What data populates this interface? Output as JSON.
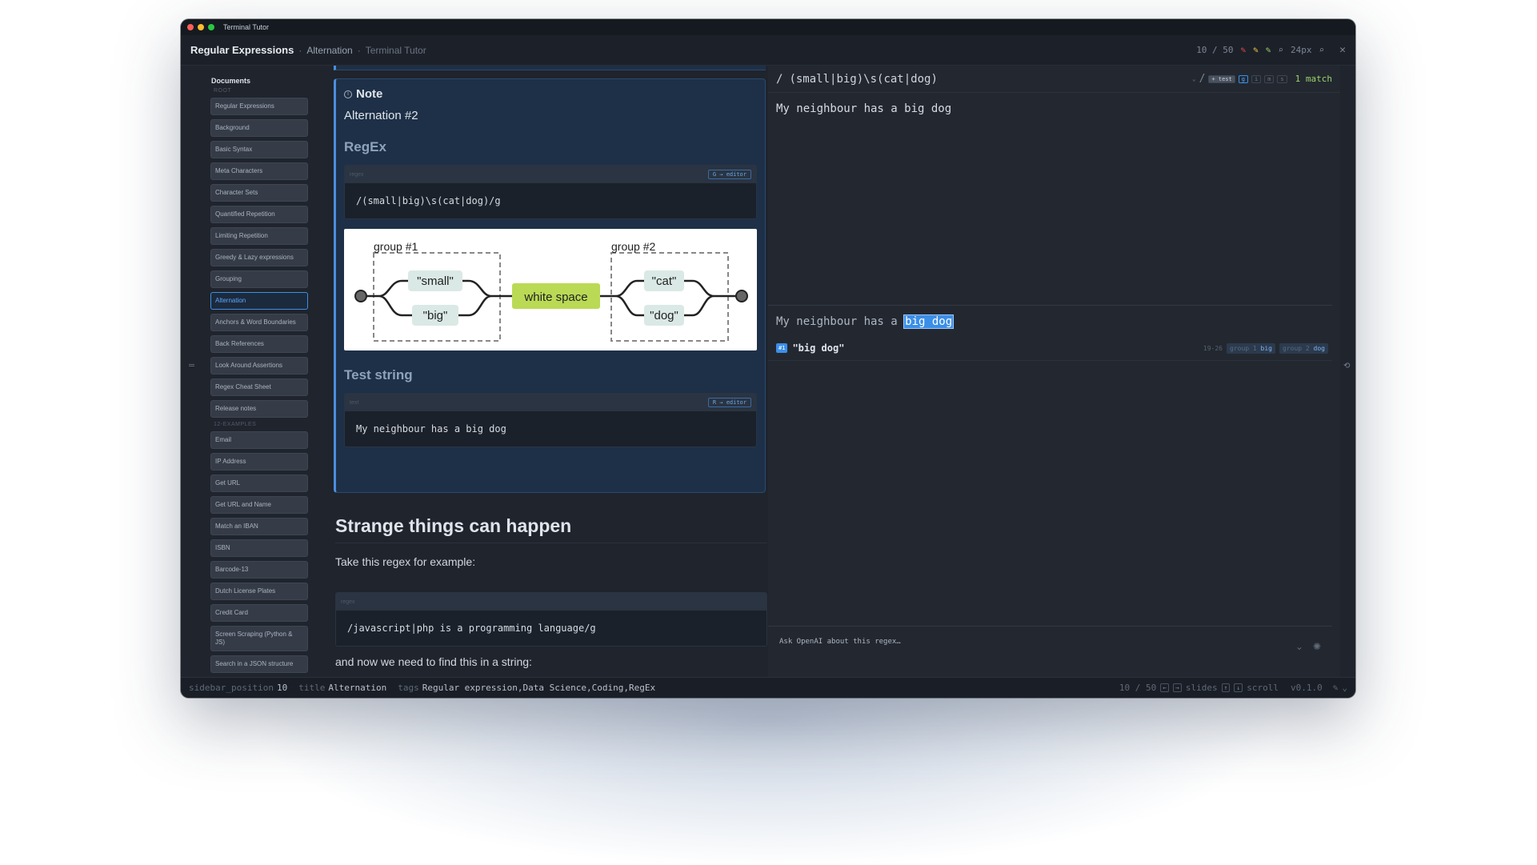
{
  "window": {
    "title": "Terminal Tutor"
  },
  "header": {
    "breadcrumb_main": "Regular Expressions",
    "breadcrumb_page": "Alternation",
    "breadcrumb_app": "Terminal Tutor",
    "page_counter": "10 / 50",
    "zoom": "24px"
  },
  "sidebar": {
    "heading": "Documents",
    "root_label": "ROOT",
    "items": [
      "Regular Expressions",
      "Background",
      "Basic Syntax",
      "Meta Characters",
      "Character Sets",
      "Quantified Repetition",
      "Limiting Repetition",
      "Greedy & Lazy expressions",
      "Grouping",
      "Alternation",
      "Anchors & Word Boundaries",
      "Back References",
      "Look Around Assertions",
      "Regex Cheat Sheet",
      "Release notes"
    ],
    "examples_label": "12-EXAMPLES",
    "examples": [
      "Email",
      "IP Address",
      "Get URL",
      "Get URL and Name",
      "Match an IBAN",
      "ISBN",
      "Barcode-13",
      "Dutch License Plates",
      "Credit Card",
      "Screen Scraping (Python & JS)",
      "Search in a JSON structure"
    ]
  },
  "document": {
    "note_title": "Note",
    "note_subtitle": "Alternation #2",
    "regex_heading": "RegEx",
    "regex_lang": "regex",
    "regex_edit": "G → editor",
    "regex_code": "/(small|big)\\s(cat|dog)/g",
    "diagram": {
      "group1": "group #1",
      "group2": "group #2",
      "small": "\"small\"",
      "big": "\"big\"",
      "space": "white space",
      "cat": "\"cat\"",
      "dog": "\"dog\""
    },
    "test_heading": "Test string",
    "test_lang": "text",
    "test_edit": "R → editor",
    "test_code": "My neighbour has a big dog",
    "h2": "Strange things can happen",
    "p1": "Take this regex for example:",
    "code2_lang": "regex",
    "code2": "/javascript|php is a programming language/g",
    "p2": "and now we need to find this in a string:"
  },
  "regex_panel": {
    "slash": "/",
    "expression": "(small|big)\\s(cat|dog)",
    "end_slash": "/",
    "flag_test": "+ test",
    "flags": [
      "g",
      "i",
      "m",
      "s"
    ],
    "match_count": "1 match",
    "input": "My neighbour has a big dog",
    "result_prefix": "My neighbour has a ",
    "result_match": "big dog",
    "match_badge": "#1",
    "match_text": "\"big dog\"",
    "match_range": "19-26",
    "group1_label": "group 1",
    "group1_value": "big",
    "group2_label": "group 2",
    "group2_value": "dog",
    "ask_placeholder": "Ask OpenAI about this regex…"
  },
  "status": {
    "k1": "sidebar_position",
    "v1": "10",
    "k2": "title",
    "v2": "Alternation",
    "k3": "tags",
    "v3": "Regular expression,Data Science,Coding,RegEx",
    "counter": "10 / 50",
    "slides_label": "slides",
    "scroll_label": "scroll",
    "version": "v0.1.0"
  }
}
